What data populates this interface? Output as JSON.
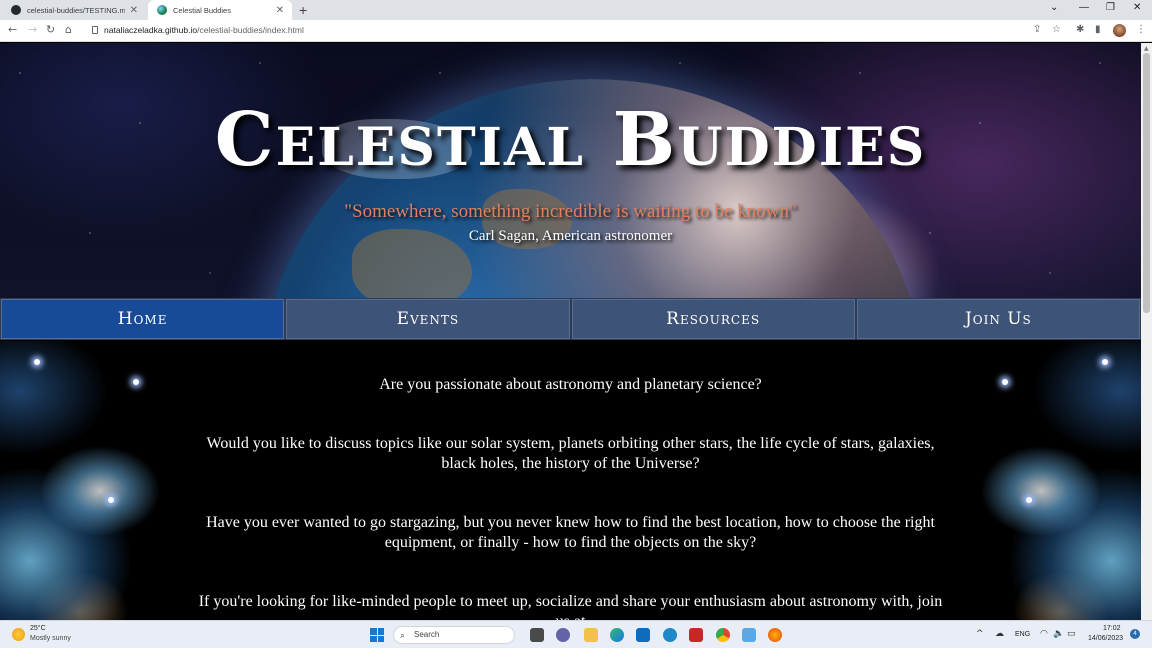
{
  "browser": {
    "tabs": [
      {
        "title": "celestial-buddies/TESTING.md at",
        "icon": "github-icon"
      },
      {
        "title": "Celestial Buddies",
        "icon": "globe-icon"
      }
    ],
    "url_domain": "nataliaczeladka.github.io",
    "url_path": "/celestial-buddies/index.html"
  },
  "hero": {
    "title": "Celestial Buddies",
    "quote": "\"Somewhere, something incredible is waiting to be known\"",
    "quote_author": "Carl Sagan, American astronomer"
  },
  "nav": {
    "items": [
      "Home",
      "Events",
      "Resources",
      "Join Us"
    ],
    "active": "Home",
    "active_color": "#174a97",
    "color": "#3d5377"
  },
  "content": {
    "paragraphs": [
      "Are you passionate about astronomy and planetary science?",
      "Would you like to discuss topics like our solar system, planets orbiting other stars, the life cycle of stars, galaxies, black holes, the history of the Universe?",
      "Have you ever wanted to go stargazing, but you never knew how to find the best location, how to choose the right equipment, or finally - how to find the objects on the sky?",
      "If you're looking for like-minded people to meet up, socialize and share your enthusiasm about astronomy with, join us at"
    ]
  },
  "taskbar": {
    "weather_temp": "25°C",
    "weather_desc": "Mostly sunny",
    "search_placeholder": "Search",
    "language": "ENG",
    "time": "17:02",
    "date": "14/06/2023",
    "notification_count": "4"
  }
}
